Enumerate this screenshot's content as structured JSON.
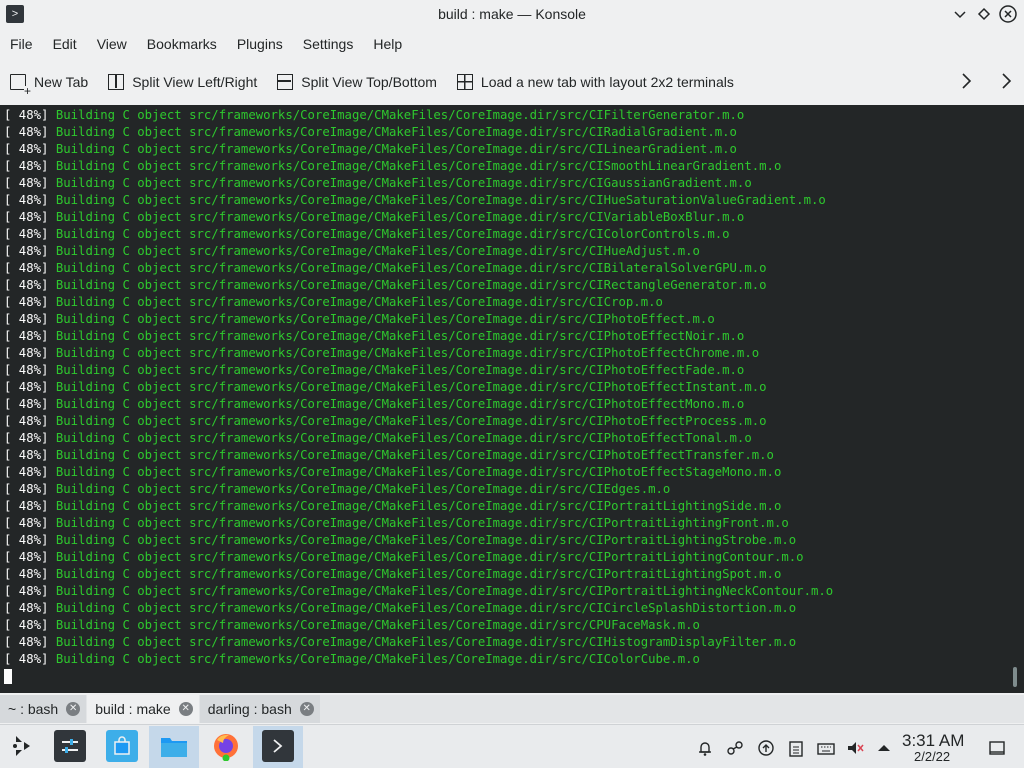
{
  "window": {
    "title": "build : make — Konsole",
    "app_icon": "terminal-icon",
    "controls": [
      "chevron-down-icon",
      "diamond-icon",
      "close-icon"
    ]
  },
  "menu": [
    "File",
    "Edit",
    "View",
    "Bookmarks",
    "Plugins",
    "Settings",
    "Help"
  ],
  "toolbar": {
    "new_tab": "New Tab",
    "split_lr": "Split View Left/Right",
    "split_tb": "Split View Top/Bottom",
    "layout_2x2": "Load a new tab with layout 2x2 terminals"
  },
  "terminal": {
    "colors": {
      "background": "#232627",
      "percent": "#fcfcfc",
      "message": "#2ec82e"
    },
    "lines": [
      {
        "pct": "[ 48%] ",
        "msg": "Building C object src/frameworks/CoreImage/CMakeFiles/CoreImage.dir/src/CIFilterGenerator.m.o"
      },
      {
        "pct": "[ 48%] ",
        "msg": "Building C object src/frameworks/CoreImage/CMakeFiles/CoreImage.dir/src/CIRadialGradient.m.o"
      },
      {
        "pct": "[ 48%] ",
        "msg": "Building C object src/frameworks/CoreImage/CMakeFiles/CoreImage.dir/src/CILinearGradient.m.o"
      },
      {
        "pct": "[ 48%] ",
        "msg": "Building C object src/frameworks/CoreImage/CMakeFiles/CoreImage.dir/src/CISmoothLinearGradient.m.o"
      },
      {
        "pct": "[ 48%] ",
        "msg": "Building C object src/frameworks/CoreImage/CMakeFiles/CoreImage.dir/src/CIGaussianGradient.m.o"
      },
      {
        "pct": "[ 48%] ",
        "msg": "Building C object src/frameworks/CoreImage/CMakeFiles/CoreImage.dir/src/CIHueSaturationValueGradient.m.o"
      },
      {
        "pct": "[ 48%] ",
        "msg": "Building C object src/frameworks/CoreImage/CMakeFiles/CoreImage.dir/src/CIVariableBoxBlur.m.o"
      },
      {
        "pct": "[ 48%] ",
        "msg": "Building C object src/frameworks/CoreImage/CMakeFiles/CoreImage.dir/src/CIColorControls.m.o"
      },
      {
        "pct": "[ 48%] ",
        "msg": "Building C object src/frameworks/CoreImage/CMakeFiles/CoreImage.dir/src/CIHueAdjust.m.o"
      },
      {
        "pct": "[ 48%] ",
        "msg": "Building C object src/frameworks/CoreImage/CMakeFiles/CoreImage.dir/src/CIBilateralSolverGPU.m.o"
      },
      {
        "pct": "[ 48%] ",
        "msg": "Building C object src/frameworks/CoreImage/CMakeFiles/CoreImage.dir/src/CIRectangleGenerator.m.o"
      },
      {
        "pct": "[ 48%] ",
        "msg": "Building C object src/frameworks/CoreImage/CMakeFiles/CoreImage.dir/src/CICrop.m.o"
      },
      {
        "pct": "[ 48%] ",
        "msg": "Building C object src/frameworks/CoreImage/CMakeFiles/CoreImage.dir/src/CIPhotoEffect.m.o"
      },
      {
        "pct": "[ 48%] ",
        "msg": "Building C object src/frameworks/CoreImage/CMakeFiles/CoreImage.dir/src/CIPhotoEffectNoir.m.o"
      },
      {
        "pct": "[ 48%] ",
        "msg": "Building C object src/frameworks/CoreImage/CMakeFiles/CoreImage.dir/src/CIPhotoEffectChrome.m.o"
      },
      {
        "pct": "[ 48%] ",
        "msg": "Building C object src/frameworks/CoreImage/CMakeFiles/CoreImage.dir/src/CIPhotoEffectFade.m.o"
      },
      {
        "pct": "[ 48%] ",
        "msg": "Building C object src/frameworks/CoreImage/CMakeFiles/CoreImage.dir/src/CIPhotoEffectInstant.m.o"
      },
      {
        "pct": "[ 48%] ",
        "msg": "Building C object src/frameworks/CoreImage/CMakeFiles/CoreImage.dir/src/CIPhotoEffectMono.m.o"
      },
      {
        "pct": "[ 48%] ",
        "msg": "Building C object src/frameworks/CoreImage/CMakeFiles/CoreImage.dir/src/CIPhotoEffectProcess.m.o"
      },
      {
        "pct": "[ 48%] ",
        "msg": "Building C object src/frameworks/CoreImage/CMakeFiles/CoreImage.dir/src/CIPhotoEffectTonal.m.o"
      },
      {
        "pct": "[ 48%] ",
        "msg": "Building C object src/frameworks/CoreImage/CMakeFiles/CoreImage.dir/src/CIPhotoEffectTransfer.m.o"
      },
      {
        "pct": "[ 48%] ",
        "msg": "Building C object src/frameworks/CoreImage/CMakeFiles/CoreImage.dir/src/CIPhotoEffectStageMono.m.o"
      },
      {
        "pct": "[ 48%] ",
        "msg": "Building C object src/frameworks/CoreImage/CMakeFiles/CoreImage.dir/src/CIEdges.m.o"
      },
      {
        "pct": "[ 48%] ",
        "msg": "Building C object src/frameworks/CoreImage/CMakeFiles/CoreImage.dir/src/CIPortraitLightingSide.m.o"
      },
      {
        "pct": "[ 48%] ",
        "msg": "Building C object src/frameworks/CoreImage/CMakeFiles/CoreImage.dir/src/CIPortraitLightingFront.m.o"
      },
      {
        "pct": "[ 48%] ",
        "msg": "Building C object src/frameworks/CoreImage/CMakeFiles/CoreImage.dir/src/CIPortraitLightingStrobe.m.o"
      },
      {
        "pct": "[ 48%] ",
        "msg": "Building C object src/frameworks/CoreImage/CMakeFiles/CoreImage.dir/src/CIPortraitLightingContour.m.o"
      },
      {
        "pct": "[ 48%] ",
        "msg": "Building C object src/frameworks/CoreImage/CMakeFiles/CoreImage.dir/src/CIPortraitLightingSpot.m.o"
      },
      {
        "pct": "[ 48%] ",
        "msg": "Building C object src/frameworks/CoreImage/CMakeFiles/CoreImage.dir/src/CIPortraitLightingNeckContour.m.o"
      },
      {
        "pct": "[ 48%] ",
        "msg": "Building C object src/frameworks/CoreImage/CMakeFiles/CoreImage.dir/src/CICircleSplashDistortion.m.o"
      },
      {
        "pct": "[ 48%] ",
        "msg": "Building C object src/frameworks/CoreImage/CMakeFiles/CoreImage.dir/src/CPUFaceMask.m.o"
      },
      {
        "pct": "[ 48%] ",
        "msg": "Building C object src/frameworks/CoreImage/CMakeFiles/CoreImage.dir/src/CIHistogramDisplayFilter.m.o"
      },
      {
        "pct": "[ 48%] ",
        "msg": "Building C object src/frameworks/CoreImage/CMakeFiles/CoreImage.dir/src/CIColorCube.m.o"
      }
    ]
  },
  "tabs": [
    {
      "label": "~ : bash",
      "active": false
    },
    {
      "label": "build : make",
      "active": true
    },
    {
      "label": "darling : bash",
      "active": false
    }
  ],
  "taskbar": {
    "launcher_icon": "kde-launcher-icon",
    "apps": [
      "system-settings-icon",
      "discover-icon",
      "file-manager-icon",
      "firefox-icon",
      "konsole-icon"
    ],
    "tray": [
      "notifications-icon",
      "kdeconnect-icon",
      "updates-icon",
      "clipboard-icon",
      "keyboard-icon",
      "volume-muted-icon",
      "expand-tray-icon"
    ],
    "time": "3:31 AM",
    "date": "2/2/22",
    "show_desktop_icon": "show-desktop-icon"
  }
}
